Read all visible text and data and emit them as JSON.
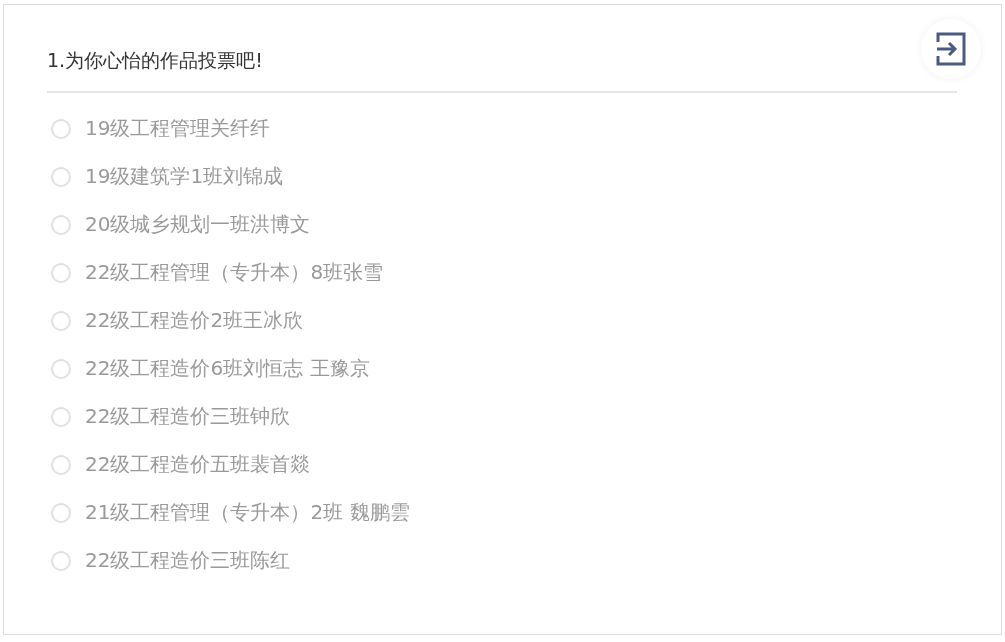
{
  "question": {
    "title": "1.为你心怡的作品投票吧!",
    "options": [
      {
        "label": "19级工程管理关纤纤",
        "selected": false,
        "disabled": true
      },
      {
        "label": "19级建筑学1班刘锦成",
        "selected": false,
        "disabled": true
      },
      {
        "label": "20级城乡规划一班洪博文",
        "selected": false,
        "disabled": true
      },
      {
        "label": "22级工程管理（专升本）8班张雪",
        "selected": false,
        "disabled": true
      },
      {
        "label": "22级工程造价2班王冰欣",
        "selected": false,
        "disabled": true
      },
      {
        "label": "22级工程造价6班刘恒志 王豫京",
        "selected": false,
        "disabled": true
      },
      {
        "label": "22级工程造价三班钟欣",
        "selected": false,
        "disabled": true
      },
      {
        "label": "22级工程造价五班裴首燚",
        "selected": false,
        "disabled": true
      },
      {
        "label": "21级工程管理（专升本）2班 魏鹏雲",
        "selected": false,
        "disabled": true
      },
      {
        "label": "22级工程造价三班陈红",
        "selected": false,
        "disabled": true
      }
    ]
  }
}
